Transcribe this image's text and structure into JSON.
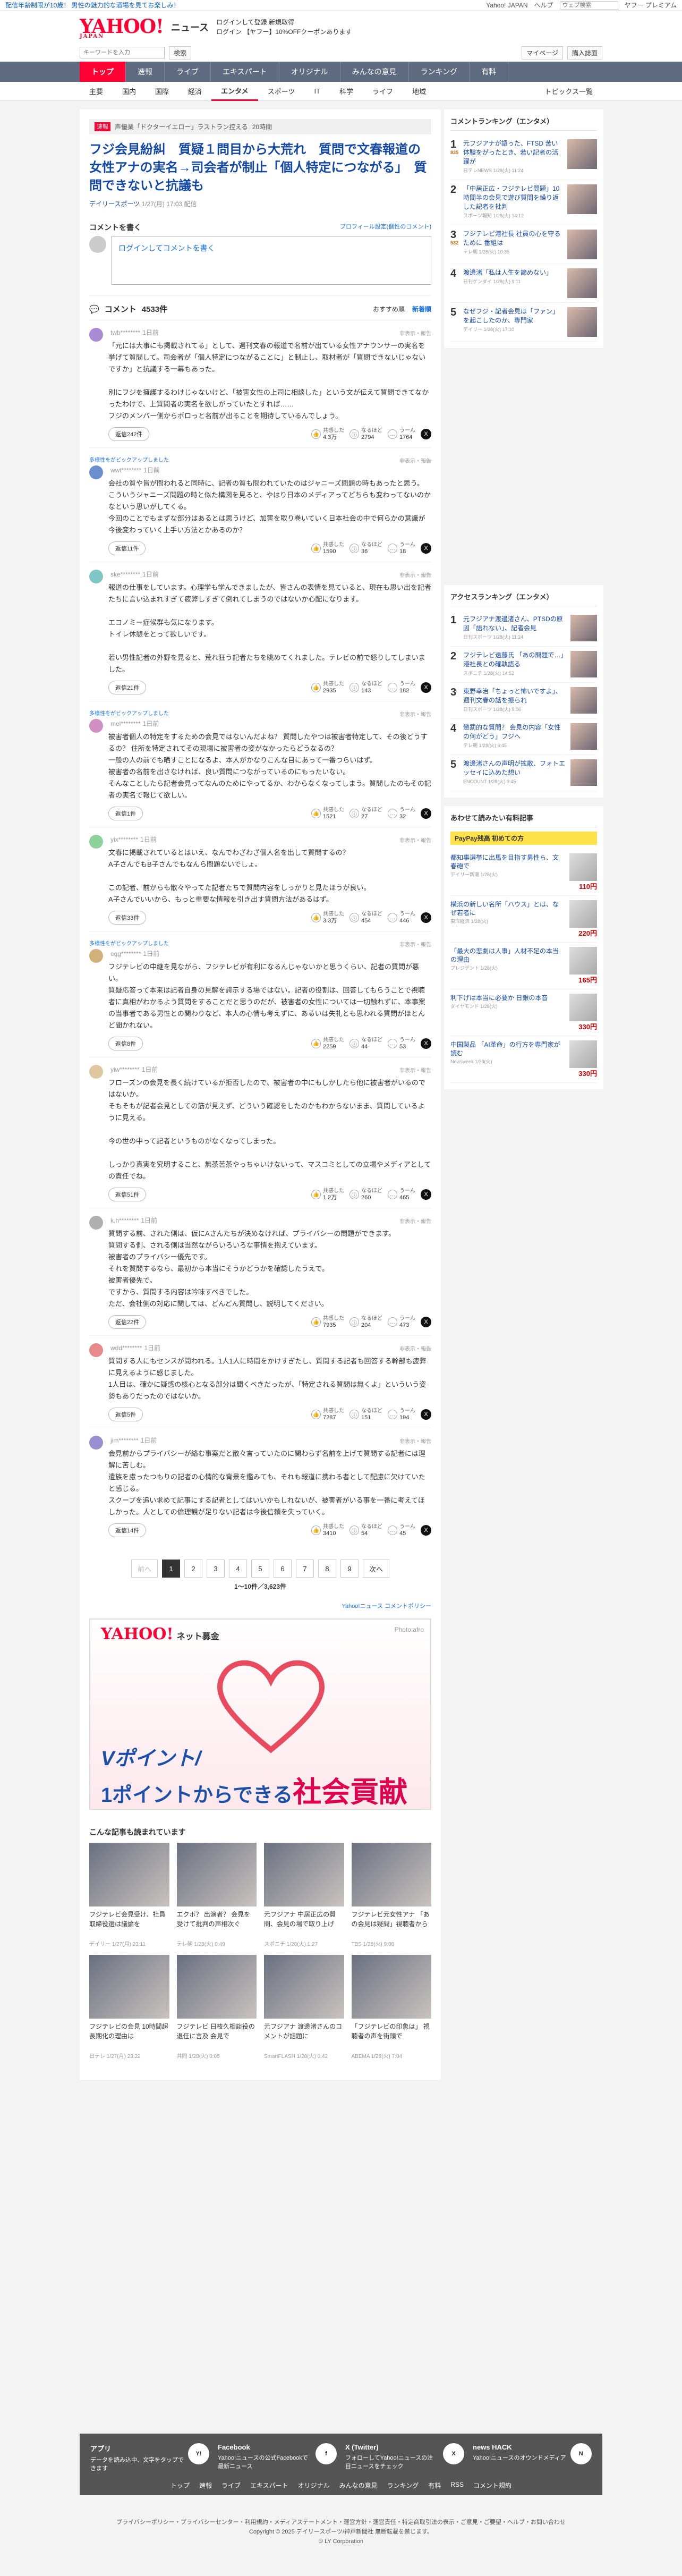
{
  "topbar": {
    "announcement": "配信年齢制限が10歳！ 男性の魅力的な酒場を見てお楽しみ！",
    "links": [
      "Yahoo! JAPAN",
      "ヘルプ"
    ],
    "search_placeholder": "ウェブ検索",
    "premium": "ヤフー プレミアム"
  },
  "header": {
    "logo": "YAHOO!",
    "logo_sub": "JAPAN",
    "section": "ニュース",
    "line1": "ログインして登録 新規取得",
    "line2": "ログイン 【ヤフー】10%OFFクーポンあります"
  },
  "searchbar": {
    "placeholder": "キーワードを入力",
    "search_label": "検索",
    "mypage": "マイページ",
    "premium": "購入誌面"
  },
  "nav": [
    "トップ",
    "速報",
    "ライブ",
    "エキスパート",
    "オリジナル",
    "みんなの意見",
    "ランキング",
    "有料"
  ],
  "subnav": [
    "主要",
    "国内",
    "国際",
    "経済",
    "エンタメ",
    "スポーツ",
    "IT",
    "科学",
    "ライフ",
    "地域"
  ],
  "subnav_right": "トピックス一覧",
  "breadcrumb": {
    "tag": "速報",
    "text": "声優業「ドクターイエロー」ラストラン控える",
    "time": "20時間"
  },
  "article": {
    "title": "フジ会見紛糾　質疑１問目から大荒れ　質問で文春報道の女性アナの実名→司会者が制止「個人特定につながる」　質問できないと抗議も",
    "source": "デイリースポーツ",
    "date": "1/27(月) 17:03 配信"
  },
  "comment_form": {
    "heading": "コメントを書く",
    "profile_link": "プロフィール設定(個性のコメント)",
    "prompt": "ログインしてコメントを書く"
  },
  "comments_header": {
    "label": "コメント",
    "count": "4533件",
    "sort_recommend": "おすすめ順",
    "sort_new": "新着順"
  },
  "comments": [
    {
      "expert": "",
      "user": "twb********",
      "time": "1日前",
      "text": "「元には大事にも掲載されてる」として、週刊文春の報道で名前が出ている女性アナウンサーの実名を挙げて質問して。司会者が「個人特定につながることに」と制止し、取材者が「質問できないじゃないですか」と抗議する一幕もあった。\n\n別にフジを擁護するわけじゃないけど、「被害女性の上司に相談した」という文が伝えて質問できてなかったわけで、上質問者の実名を欲しがっていたとすれば……\nフジのメンバー側からボロっと名前が出ることを期待しているんでしょう。",
      "replies": "返信242件",
      "r1": "4.3万",
      "r2": "2794",
      "r3": "1764",
      "avatar": "#a98bd4"
    },
    {
      "expert": "多様性をがビックアップしました",
      "user": "wwt********",
      "time": "1日前",
      "text": "会社の質や皆が問われると同時に、記者の質も問われていたのはジャニーズ問題の時もあったと思う。\nこういうジャニーズ問題の時と似た構図を見ると、やはり日本のメディアってどちらも変わってないのかなという思いがしてくる。\n今回のことでもまずな部分はあるとは思うけど、加害を取り巻いていく日本社会の中で何らかの意識が今後変わっていく上手い方法とかあるのか？",
      "replies": "返信11件",
      "r1": "1590",
      "r2": "36",
      "r3": "18",
      "avatar": "#6c8fd1"
    },
    {
      "expert": "",
      "user": "ske********",
      "time": "1日前",
      "text": "報道の仕事をしています。心理学も学んできましたが、皆さんの表情を見ていると、現在も思い出を記者たちに言い込まれすぎて疲弊しすぎて倒れてしまうのではないか心配になります。\n\nエコノミー症候群も気になります。\nトイレ休憩をとって欲しいです。\n\n若い男性記者の外野を見ると、荒れ狂う記者たちを眺めてくれました。テレビの前で怒りしてしまいました。",
      "replies": "返信21件",
      "r1": "2935",
      "r2": "143",
      "r3": "182",
      "avatar": "#7fc7c7"
    },
    {
      "expert": "多様性をがビックアップしました",
      "user": "mel********",
      "time": "1日前",
      "text": "被害者個人の特定をするための会見ではないんだよね？ 質問したやつは被害者特定して、その後どうするの？ 住所を特定されてその現場に被害者の姿がなかったらどうなるの？\n一般の人の前でも晒すことになるよ、本人がかなりこんな目にあって一番つらいはず。\n被害者の名前を出さなければ、良い質問につながっているのにもったいない。\nそんなことしたら記者会見ってなんのためにやってるか、わからなくなってしまう。質問したのもその記者の実名で報じて欲しい。",
      "replies": "返信1件",
      "r1": "1521",
      "r2": "27",
      "r3": "32",
      "avatar": "#d18fc4"
    },
    {
      "expert": "",
      "user": "yix********",
      "time": "1日前",
      "text": "文春に掲載されているとはいえ、なんでわざわざ個人名を出して質問するの？\nA子さんでもB子さんでもなんら問題ないでしょ。\n\nこの記者、前からも散々やってた記者たちで質問内容をしっかりと見たほうが良い。\nA子さんでいいから、もっと重要な情報を引き出す質問方法があるはず。",
      "replies": "返信33件",
      "r1": "3.3万",
      "r2": "454",
      "r3": "446",
      "avatar": "#8fd19a"
    },
    {
      "expert": "多様性をがビックアップしました",
      "user": "egg********",
      "time": "1日前",
      "text": "フジテレビの中継を見ながら、フジテレビが有利になるんじゃないかと思うくらい、記者の質問が悪い。\n質疑応答って本来は記者自身の見解を誇示する場ではない。記者の役割は、回答してもらうことで視聴者に真相がわかるよう質問をすることだと思うのだが、被害者の女性については一切触れずに、本事案の当事者である男性との関わりなど、本人の心情も考えずに、あるいは失礼とも思われる質問がほとんど聞かれない。",
      "replies": "返信8件",
      "r1": "2259",
      "r2": "44",
      "r3": "53",
      "avatar": "#d1b07a"
    },
    {
      "expert": "",
      "user": "yiw********",
      "time": "1日前",
      "text": "フローズンの会見を長く続けているが拒否したので、被害者の中にもしかしたら他に被害者がいるのではないか。\nそもそもが記者会見としての筋が見えず、どういう確認をしたのかもわからないまま、質問しているように見える。\n\n今の世の中って記者というものがなくなってしまった。\n\nしっかり真実を究明すること、無茶苦茶やっちゃいけないって、マスコミとしての立場やメディアとしての責任でね。",
      "replies": "返信51件",
      "r1": "1.2万",
      "r2": "260",
      "r3": "465",
      "avatar": "#e0c7a0"
    },
    {
      "expert": "",
      "user": "k.h********",
      "time": "1日前",
      "text": "質問する前、された側は、仮にAさんたちが決めなければ、プライバシーの問題ができます。\n質問する側、される側は当然ながらいろいろな事情を抱えています。\n被害者のプライバシー優先です。\nそれを質問するなら、最初から本当にそうかどうかを確認したうえで。\n被害者優先で。\nですから、質問する内容は吟味すべきでした。\nただ、会社側の対応に関しては、どんどん質問し、説明してください。",
      "replies": "返信22件",
      "r1": "7935",
      "r2": "204",
      "r3": "473",
      "avatar": "#b0b0b0"
    },
    {
      "expert": "",
      "user": "wdd********",
      "time": "1日前",
      "text": "質問する人にもセンスが問われる。1人1人に時間をかけすぎたし、質問する記者も回答する幹部も疲弊に見えるように感じました。\n1人目は、確かに疑惑の核心となる部分は聞くべきだったが、「特定される質問は無くよ」といういう姿勢もありだったのではないか。",
      "replies": "返信5件",
      "r1": "7287",
      "r2": "151",
      "r3": "194",
      "avatar": "#e88a8a"
    },
    {
      "expert": "",
      "user": "jim********",
      "time": "1日前",
      "text": "会見前からプライバシーが絡む事案だと散々言っていたのに関わらず名前を上げて質問する記者には理解に苦しむ。\n遺族を慮ったつもりの記者の心情的な背景を鑑みても、それも報道に携わる者として配慮に欠けていたと感じる。\nスクープを追い求めて記事にする記者としてはいいかもしれないが、被害者がいる事を一番に考えてほしかった。人としての倫理観が足りない記者は今後信頼を失っていく。",
      "replies": "返信14件",
      "r1": "3410",
      "r2": "54",
      "r3": "45",
      "avatar": "#9a8fd1"
    }
  ],
  "pager": {
    "prev": "前へ",
    "pages": [
      "1",
      "2",
      "3",
      "4",
      "5",
      "6",
      "7",
      "8",
      "9"
    ],
    "next": "次へ",
    "info": "1〜10件／3,623件"
  },
  "policy_link": "Yahoo!ニュース コメントポリシー",
  "banner": {
    "brand": "YAHOO!",
    "brand_sub": "ネット募金",
    "photo": "Photo:afro",
    "line1": "Vポイント/",
    "line2a": "1ポイントからできる",
    "line2b": "社会貢献"
  },
  "recs_title": "こんな記事も読まれています",
  "recs": [
    {
      "t": "フジテレビ会見受け、社員 取締役選は議論を",
      "m": "デイリー 1/27(月) 23:11"
    },
    {
      "t": "エクボ？ 出演者？ 会見を受けて批判の声相次ぐ",
      "m": "テレ朝 1/28(火) 0:49"
    },
    {
      "t": "元フジアナ 中居正広の質問、会見の場で取り上げ",
      "m": "スポニチ 1/28(火) 1:27"
    },
    {
      "t": "フジテレビ元女性アナ 「あの会見は疑問」視聴者から",
      "m": "TBS 1/28(火) 9:08"
    },
    {
      "t": "フジテレビの会見 10時間超 長期化の理由は",
      "m": "日テレ 1/27(月) 23:22"
    },
    {
      "t": "フジテレビ 日枝久相談役の退任に言及 会見で",
      "m": "共同 1/28(火) 0:05"
    },
    {
      "t": "元フジアナ 渡邊渚さんのコメントが話題に",
      "m": "SmartFLASH 1/28(火) 0:42"
    },
    {
      "t": "「フジテレビの印象は」 視聴者の声を街頭で",
      "m": "ABEMA 1/28(火) 7:04"
    }
  ],
  "side_ranking": {
    "title": "コメントランキング（エンタメ）",
    "items": [
      {
        "n": "1",
        "badge": "835",
        "t": "元フジアナが語った、FTSD 苦い体験をがったとき、若い記者の活躍が",
        "s": "日テレNEWS 1/28(火) 11:24"
      },
      {
        "n": "2",
        "badge": "",
        "t": "「中居正広・フジテレビ問題」10時間半の会見で遊び質問を繰り返した記者を批判",
        "s": "スポーツ報知 1/28(火) 14:12"
      },
      {
        "n": "3",
        "badge": "532",
        "t": "フジテレビ港社長 社員の心を守るために 番組は",
        "s": "テレ朝 1/28(火) 10:35"
      },
      {
        "n": "4",
        "badge": "",
        "t": "渡邊渚「私は人生を諦めない」",
        "s": "日刊ゲンダイ 1/28(火) 9:11"
      },
      {
        "n": "5",
        "badge": "",
        "t": "なぜフジ・記者会見は「ファン」を起こしたのか、専門家",
        "s": "デイリー 1/28(火) 17:10"
      }
    ]
  },
  "side_access": {
    "title": "アクセスランキング（エンタメ）",
    "items": [
      {
        "n": "1",
        "t": "元フジアナ渡邊渚さん、PTSDの原因「語れない」、記者会見",
        "s": "日刊スポーツ 1/28(火) 11:24"
      },
      {
        "n": "2",
        "t": "フジテレビ遠藤氏 「あの問題で…」港社長との確執語る",
        "s": "スポニチ 1/28(火) 14:52"
      },
      {
        "n": "3",
        "t": "東野幸治「ちょっと怖いですよ」、週刊文春の話を振られ",
        "s": "日刊スポーツ 1/28(火) 9:06"
      },
      {
        "n": "4",
        "t": "懲罰的な質問？ 会見の内容「女性の何がどう」フジへ",
        "s": "テレ朝 1/28(火) 6:45"
      },
      {
        "n": "5",
        "t": "渡邊渚さんの声明が拡散、フォトエッセイに込めた想い",
        "s": "ENCOUNT 1/28(火) 9:45"
      }
    ]
  },
  "side_shop": {
    "title": "あわせて読みたい有料記事",
    "label": "PayPay残高 初めての方",
    "items": [
      {
        "t": "都知事選挙に出馬を目指す男性ら、文春砲で",
        "s": "デイリー新潮 1/28(火)",
        "p": "110円"
      },
      {
        "t": "横浜の新しい名所「ハウス」とは、なぜ若者に",
        "s": "東洋経済 1/28(火)",
        "p": "220円"
      },
      {
        "t": "「最大の悲劇は人事」人材不足の本当の理由",
        "s": "プレジデント 1/28(火)",
        "p": "165円"
      },
      {
        "t": "利下げは本当に必要か 日銀の本音",
        "s": "ダイヤモンド 1/28(火)",
        "p": "330円"
      },
      {
        "t": "中国製品 「AI革命」の行方を専門家が読む",
        "s": "Newsweek 1/28(火)",
        "p": "330円"
      }
    ]
  },
  "footer": {
    "cols": [
      {
        "title": "アプリ",
        "text": "データを読み込中、文字をタップできます",
        "icon": "Y!"
      },
      {
        "title": "Facebook",
        "text": "Yahoo!ニュースの公式Facebookで最新ニュース",
        "icon": "f"
      },
      {
        "title": "X (Twitter)",
        "text": "フォローしてYahoo!ニュースの注目ニュースをチェック",
        "icon": "X"
      },
      {
        "title": "news HACK",
        "text": "Yahoo!ニュースのオウンドメディア",
        "icon": "N"
      }
    ],
    "links": [
      "トップ",
      "速報",
      "ライブ",
      "エキスパート",
      "オリジナル",
      "みんなの意見",
      "ランキング",
      "有料",
      "RSS",
      "コメント規約"
    ],
    "legal1": "プライバシーポリシー・プライバシーセンター・利用規約・メディアステートメント・運営方針・運営責任・特定商取引法の表示・ご意見・ご要望・ヘルプ・お問い合わせ",
    "legal2": "Copyright © 2025 デイリースポーツ/神戸新聞社 無断転載を禁じます。",
    "legal3": "© LY Corporation"
  }
}
